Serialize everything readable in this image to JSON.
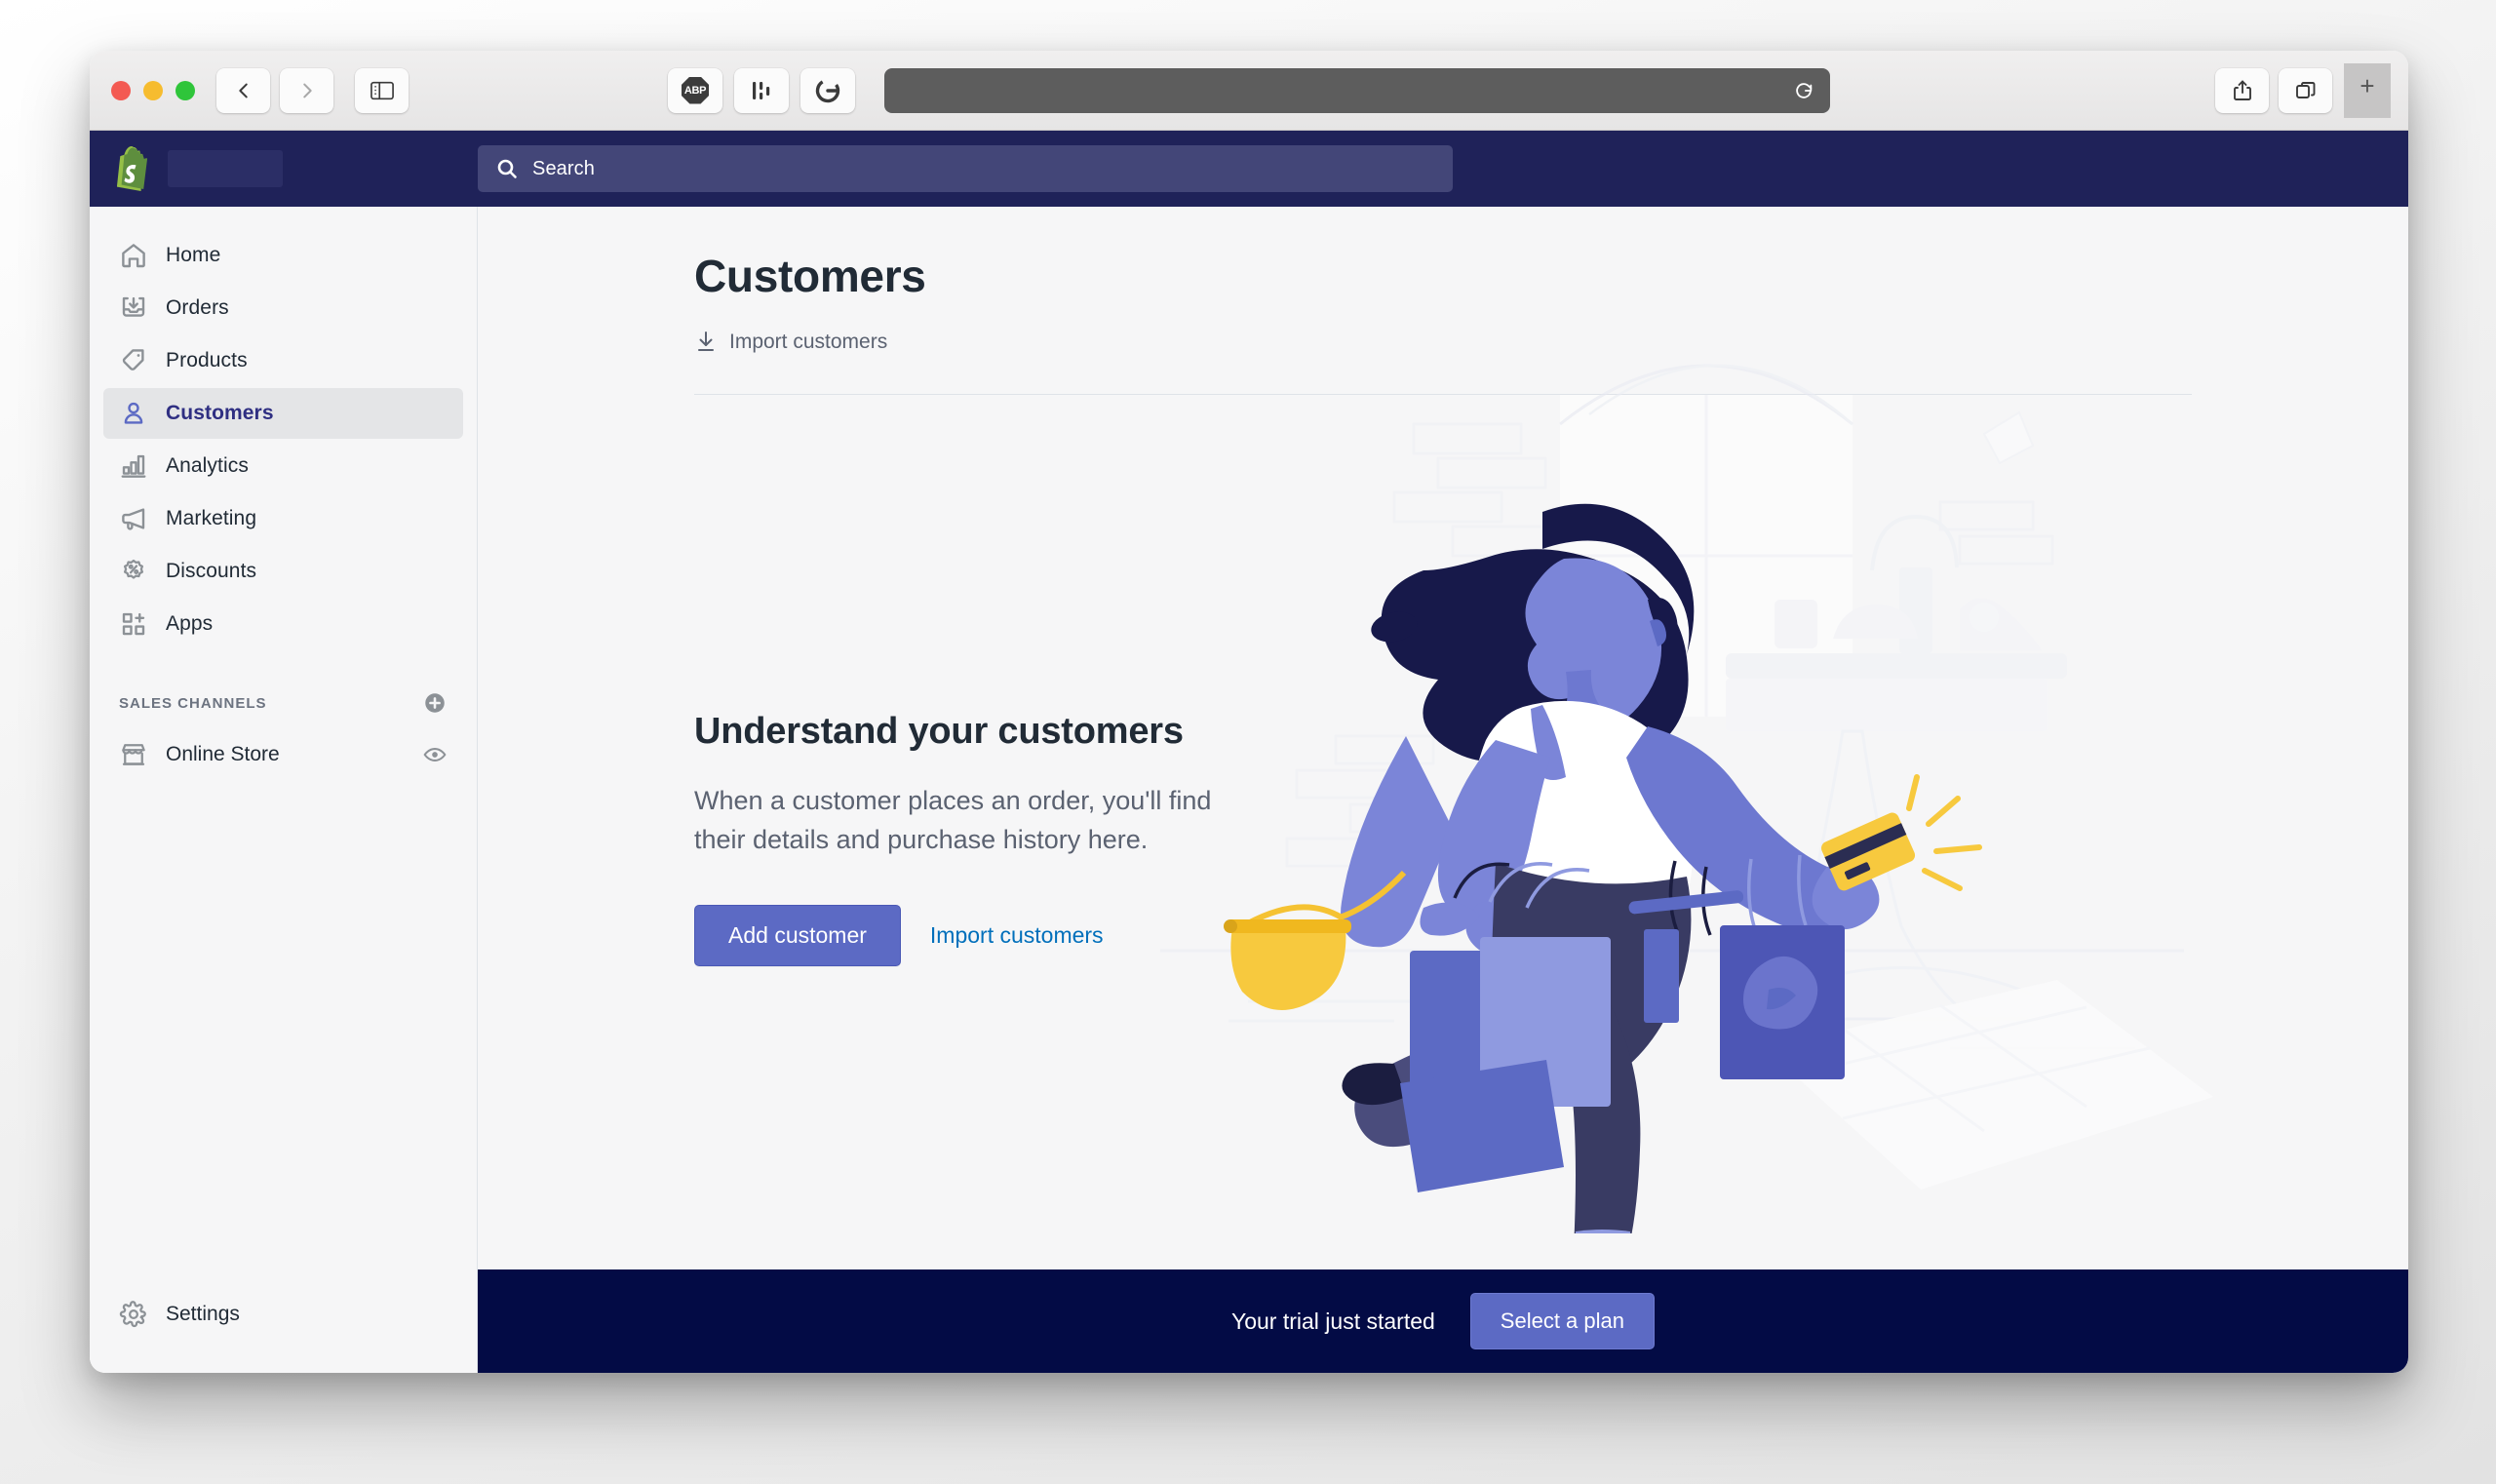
{
  "browser": {
    "traffic_lights": [
      "close",
      "minimize",
      "maximize"
    ],
    "nav": {
      "back": "back-icon",
      "forward": "forward-icon"
    },
    "sidebar_toggle": "sidebar-toggle-icon",
    "extensions": [
      {
        "name": "adblock-plus",
        "label": "ABP"
      },
      {
        "name": "columns-extension",
        "label": ""
      },
      {
        "name": "grammarly-extension",
        "label": "G"
      }
    ],
    "address_bar": {
      "value": "",
      "redacted": true,
      "reload_icon": "reload-icon"
    },
    "actions": [
      {
        "name": "share-button",
        "icon": "share-icon"
      },
      {
        "name": "tab-overview-button",
        "icon": "tabs-icon"
      }
    ],
    "new_tab_label": "+"
  },
  "topbar": {
    "logo": "shopify-logo",
    "store_name": "",
    "store_name_redacted": true,
    "search": {
      "placeholder": "Search",
      "value": "",
      "icon": "search-icon"
    },
    "bg_color": "#1f2259",
    "search_bg_color": "#434678"
  },
  "sidebar": {
    "items": [
      {
        "label": "Home",
        "icon": "home-icon",
        "active": false
      },
      {
        "label": "Orders",
        "icon": "orders-icon",
        "active": false
      },
      {
        "label": "Products",
        "icon": "tag-icon",
        "active": false
      },
      {
        "label": "Customers",
        "icon": "person-icon",
        "active": true
      },
      {
        "label": "Analytics",
        "icon": "bar-chart-icon",
        "active": false
      },
      {
        "label": "Marketing",
        "icon": "megaphone-icon",
        "active": false
      },
      {
        "label": "Discounts",
        "icon": "discount-icon",
        "active": false
      },
      {
        "label": "Apps",
        "icon": "apps-icon",
        "active": false
      }
    ],
    "sales_channels": {
      "title": "SALES CHANNELS",
      "add_icon": "plus-circle-icon",
      "channels": [
        {
          "label": "Online Store",
          "icon": "storefront-icon",
          "action_icon": "eye-icon"
        }
      ]
    },
    "settings": {
      "label": "Settings",
      "icon": "gear-icon"
    },
    "active_bg_color": "#e4e5e7",
    "active_text_color": "#2f2f82"
  },
  "main": {
    "title": "Customers",
    "import_link": {
      "label": "Import customers",
      "icon": "import-icon"
    },
    "empty_state": {
      "heading": "Understand your customers",
      "body": "When a customer places an order, you'll find their details and purchase history here.",
      "primary_button": "Add customer",
      "secondary_link": "Import customers",
      "illustration": "woman-shopping-bags-illustration"
    }
  },
  "trial_banner": {
    "message": "Your trial just started",
    "button": "Select a plan",
    "bg_color": "#030b45",
    "button_color": "#5c6ac4"
  }
}
